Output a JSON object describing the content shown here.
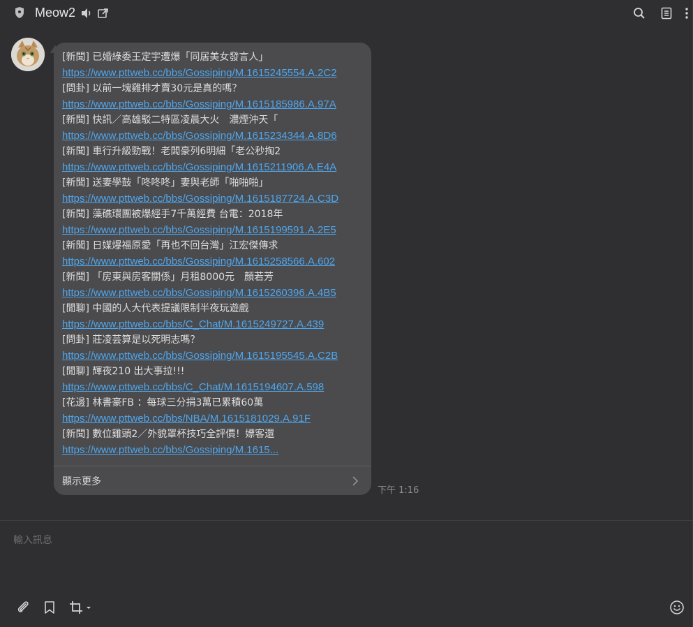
{
  "header": {
    "title": "Meow2",
    "icons": [
      "shield-icon",
      "speaker-icon",
      "external-window-icon",
      "search-icon",
      "notes-icon",
      "more-vertical-icon"
    ]
  },
  "message": {
    "lines": [
      {
        "type": "text",
        "text": "[新聞] 已婚綠委王定宇遭爆「同居美女發言人」"
      },
      {
        "type": "link",
        "text": "https://www.pttweb.cc/bbs/Gossiping/M.1615245554.A.2C2"
      },
      {
        "type": "text",
        "text": "[問卦] 以前一塊雞排才賣30元是真的嗎？"
      },
      {
        "type": "link",
        "text": "https://www.pttweb.cc/bbs/Gossiping/M.1615185986.A.97A"
      },
      {
        "type": "text",
        "text": "[新聞] 快訊／高雄駁二特區凌晨大火　濃煙沖天「"
      },
      {
        "type": "link",
        "text": "https://www.pttweb.cc/bbs/Gossiping/M.1615234344.A.8D6"
      },
      {
        "type": "text",
        "text": "[新聞] 車行升級勁戰！老闆豪列6明細「老公秒掏2"
      },
      {
        "type": "link",
        "text": "https://www.pttweb.cc/bbs/Gossiping/M.1615211906.A.E4A"
      },
      {
        "type": "text",
        "text": "[新聞] 送妻學鼓「咚咚咚」妻與老師「啪啪啪」"
      },
      {
        "type": "link",
        "text": "https://www.pttweb.cc/bbs/Gossiping/M.1615187724.A.C3D"
      },
      {
        "type": "text",
        "text": "[新聞] 藻礁環團被爆經手7千萬經費 台電：2018年"
      },
      {
        "type": "link",
        "text": "https://www.pttweb.cc/bbs/Gossiping/M.1615199591.A.2E5"
      },
      {
        "type": "text",
        "text": "[新聞] 日媒爆福原愛「再也不回台灣」江宏傑傳求"
      },
      {
        "type": "link",
        "text": "https://www.pttweb.cc/bbs/Gossiping/M.1615258566.A.602"
      },
      {
        "type": "text",
        "text": "[新聞] 「房東與房客關係」月租8000元　顏若芳"
      },
      {
        "type": "link",
        "text": "https://www.pttweb.cc/bbs/Gossiping/M.1615260396.A.4B5"
      },
      {
        "type": "text",
        "text": "[閒聊] 中國的人大代表提議限制半夜玩遊戲"
      },
      {
        "type": "link",
        "text": "https://www.pttweb.cc/bbs/C_Chat/M.1615249727.A.439"
      },
      {
        "type": "text",
        "text": "[問卦] 莊凌芸算是以死明志嗎？"
      },
      {
        "type": "link",
        "text": "https://www.pttweb.cc/bbs/Gossiping/M.1615195545.A.C2B"
      },
      {
        "type": "text",
        "text": "[閒聊] 輝夜210 出大事拉!!!"
      },
      {
        "type": "link",
        "text": "https://www.pttweb.cc/bbs/C_Chat/M.1615194607.A.598"
      },
      {
        "type": "text",
        "text": "[花邊] 林書豪FB ：每球三分捐3萬已累積60萬"
      },
      {
        "type": "link",
        "text": "https://www.pttweb.cc/bbs/NBA/M.1615181029.A.91F"
      },
      {
        "type": "text",
        "text": "[新聞] 數位雞頭2／外貌罩杯技巧全評價！嫖客還"
      },
      {
        "type": "link",
        "text": "https://www.pttweb.cc/bbs/Gossiping/M.1615..."
      }
    ],
    "show_more_label": "顯示更多",
    "time": "下午 1:16"
  },
  "composer": {
    "placeholder": "輸入訊息",
    "icons": [
      "paperclip-icon",
      "bookmark-icon",
      "crop-icon",
      "emoji-icon"
    ]
  },
  "colors": {
    "background": "#2f2f31",
    "bubble": "#4b4b4d",
    "link": "#4ea6ee",
    "text": "#dedede"
  }
}
